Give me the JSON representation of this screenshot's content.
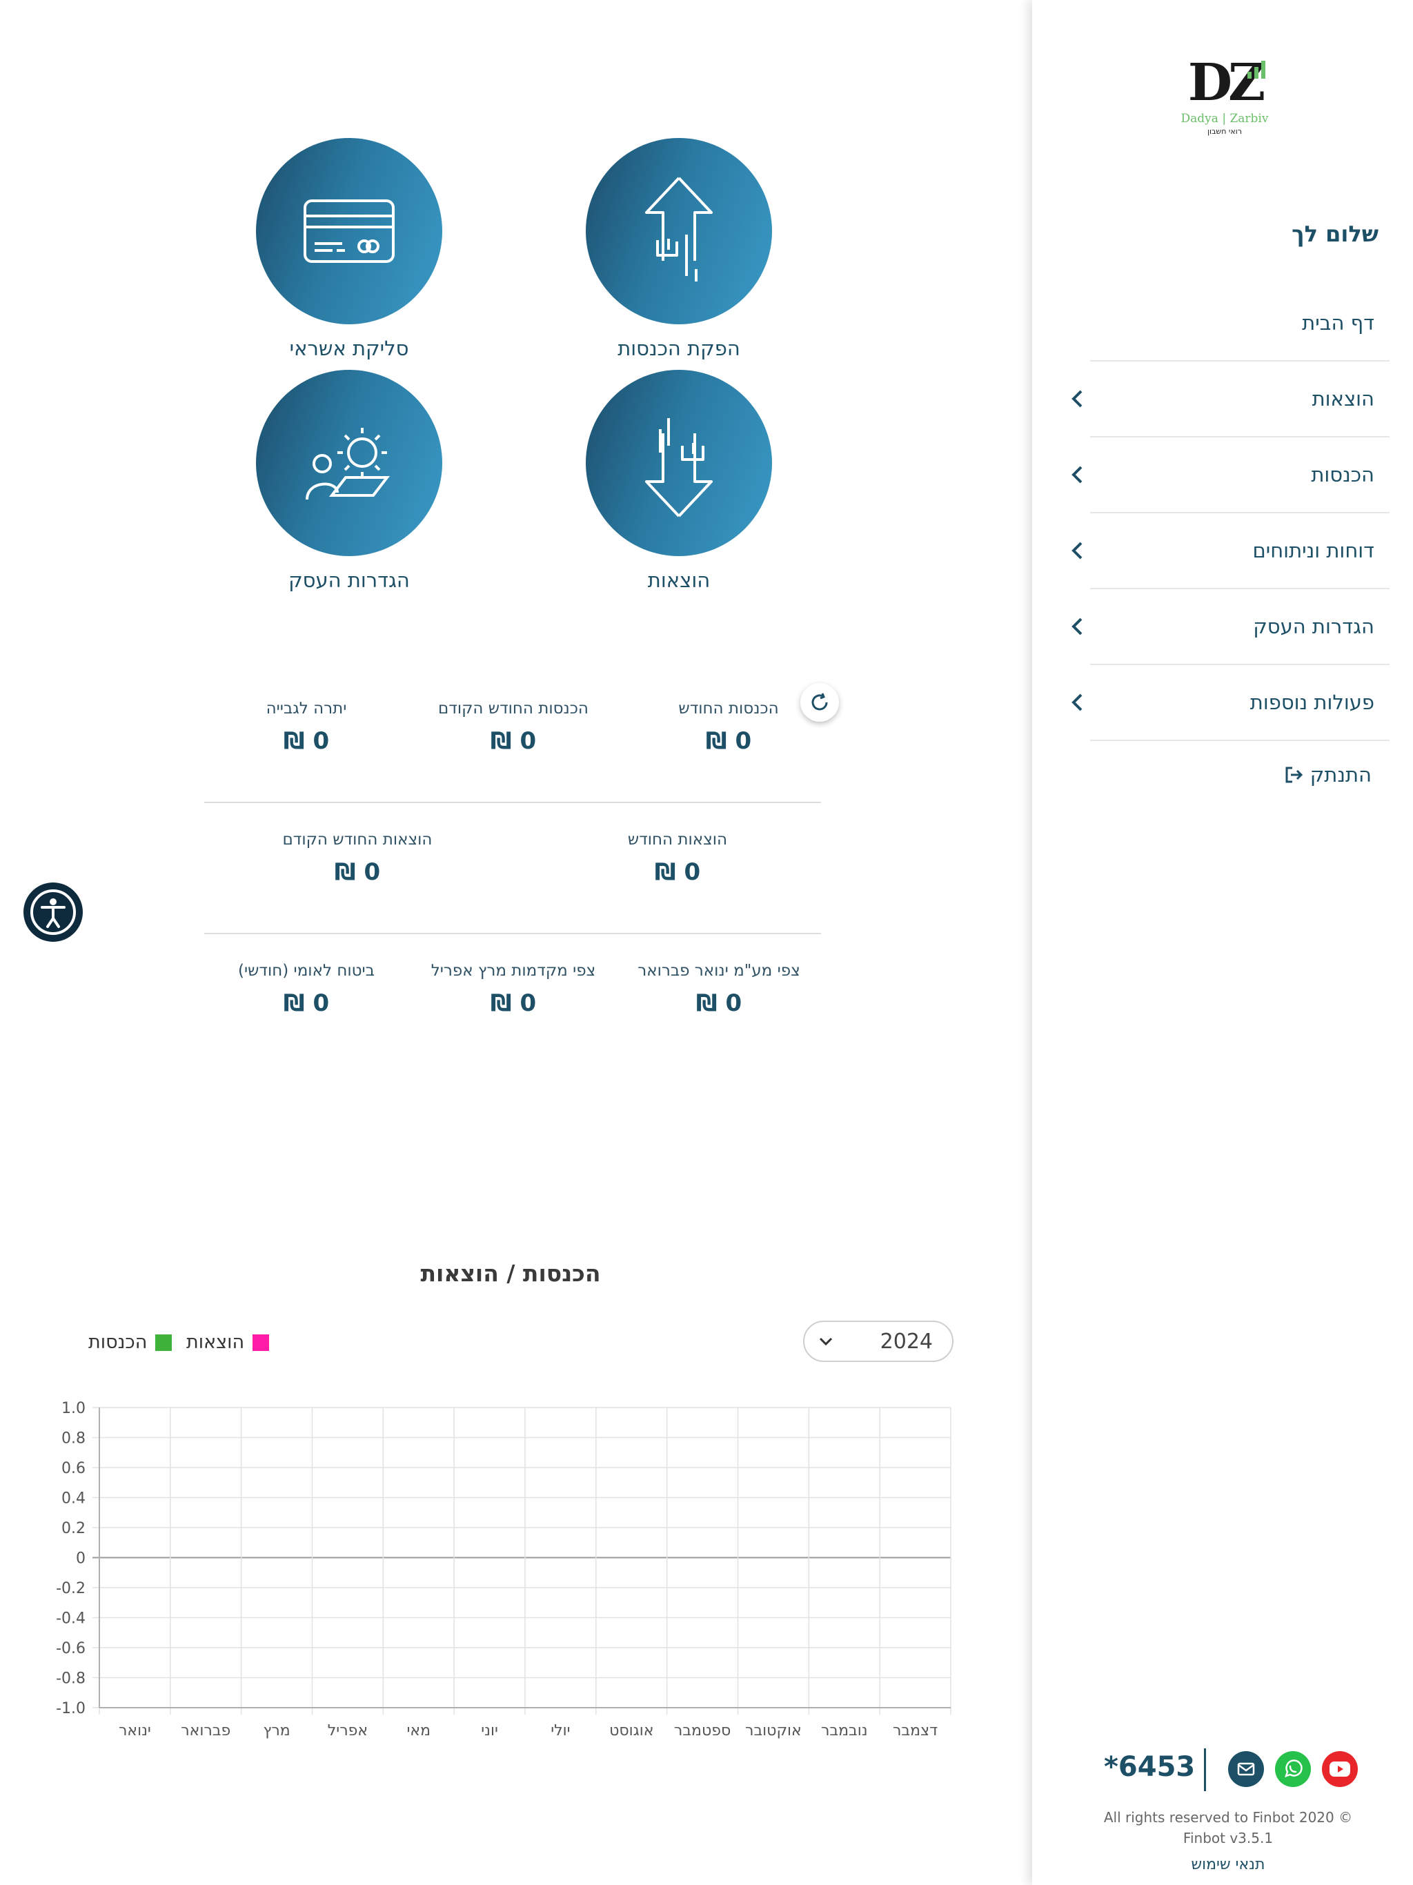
{
  "tiles": {
    "credit": "סליקת אשראי",
    "income_issue": "הפקת הכנסות",
    "settings": "הגדרות העסק",
    "expenses": "הוצאות"
  },
  "stats": {
    "row1": [
      {
        "title": "הכנסות החודש",
        "value": "0 ₪"
      },
      {
        "title": "הכנסות החודש הקודם",
        "value": "0 ₪"
      },
      {
        "title": "יתרה לגבייה",
        "value": "0 ₪"
      }
    ],
    "row2": [
      {
        "title": "הוצאות החודש",
        "value": "0 ₪"
      },
      {
        "title": "הוצאות החודש הקודם",
        "value": "0 ₪"
      }
    ],
    "row3": [
      {
        "title": "צפי מע\"מ ינואר פברואר",
        "value": "0 ₪"
      },
      {
        "title": "צפי מקדמות מרץ אפריל",
        "value": "0 ₪"
      },
      {
        "title": "ביטוח לאומי (חודשי)",
        "value": "0 ₪"
      }
    ]
  },
  "chart_section": {
    "title": "הכנסות / הוצאות",
    "year": "2024",
    "legend": [
      {
        "label": "הוצאות",
        "color": "#ff1aa8"
      },
      {
        "label": "הכנסות",
        "color": "#3fb23a"
      }
    ]
  },
  "chart_data": {
    "type": "bar",
    "title": "הכנסות / הוצאות",
    "categories": [
      "ינואר",
      "פברואר",
      "מרץ",
      "אפריל",
      "מאי",
      "יוני",
      "יולי",
      "אוגוסט",
      "ספטמבר",
      "אוקטובר",
      "נובמבר",
      "דצמבר"
    ],
    "series": [
      {
        "name": "הוצאות",
        "color": "#ff1aa8",
        "values": [
          0,
          0,
          0,
          0,
          0,
          0,
          0,
          0,
          0,
          0,
          0,
          0
        ]
      },
      {
        "name": "הכנסות",
        "color": "#3fb23a",
        "values": [
          0,
          0,
          0,
          0,
          0,
          0,
          0,
          0,
          0,
          0,
          0,
          0
        ]
      }
    ],
    "ylim": [
      -1,
      1
    ],
    "yticks": [
      {
        "value": 1,
        "label": "1.0"
      },
      {
        "value": 0.8,
        "label": "0.8"
      },
      {
        "value": 0.6,
        "label": "0.6"
      },
      {
        "value": 0.4,
        "label": "0.4"
      },
      {
        "value": 0.2,
        "label": "0.2"
      },
      {
        "value": 0,
        "label": "0"
      },
      {
        "value": -0.2,
        "label": "-0.2"
      },
      {
        "value": -0.4,
        "label": "-0.4"
      },
      {
        "value": -0.6,
        "label": "-0.6"
      },
      {
        "value": -0.8,
        "label": "-0.8"
      },
      {
        "value": -1,
        "label": "-1.0"
      }
    ],
    "grid": true,
    "legend_position": "top-left"
  },
  "sidebar": {
    "logo_main": "DZ",
    "logo_sub": "Dadya | Zarbiv",
    "logo_caption": "רואי חשבון",
    "greeting": "שלום לך",
    "nav": [
      {
        "label": "דף הבית",
        "chevron": false
      },
      {
        "label": "הוצאות",
        "chevron": true
      },
      {
        "label": "הכנסות",
        "chevron": true
      },
      {
        "label": "דוחות וניתוחים",
        "chevron": true
      },
      {
        "label": "הגדרות העסק",
        "chevron": true
      },
      {
        "label": "פעולות נוספות",
        "chevron": true
      }
    ],
    "logout": "התנתק"
  },
  "footer": {
    "phone": "*6453",
    "rights": "All rights reserved to Finbot 2020 ©",
    "version": "Finbot v3.5.1",
    "terms": "תנאי שימוש",
    "icons": {
      "mail": "mail-icon",
      "whatsapp": "whatsapp-icon",
      "youtube": "youtube-icon"
    },
    "colors": {
      "mail": "#1d4f66",
      "whatsapp": "#25c14a",
      "youtube": "#e8262a"
    }
  }
}
